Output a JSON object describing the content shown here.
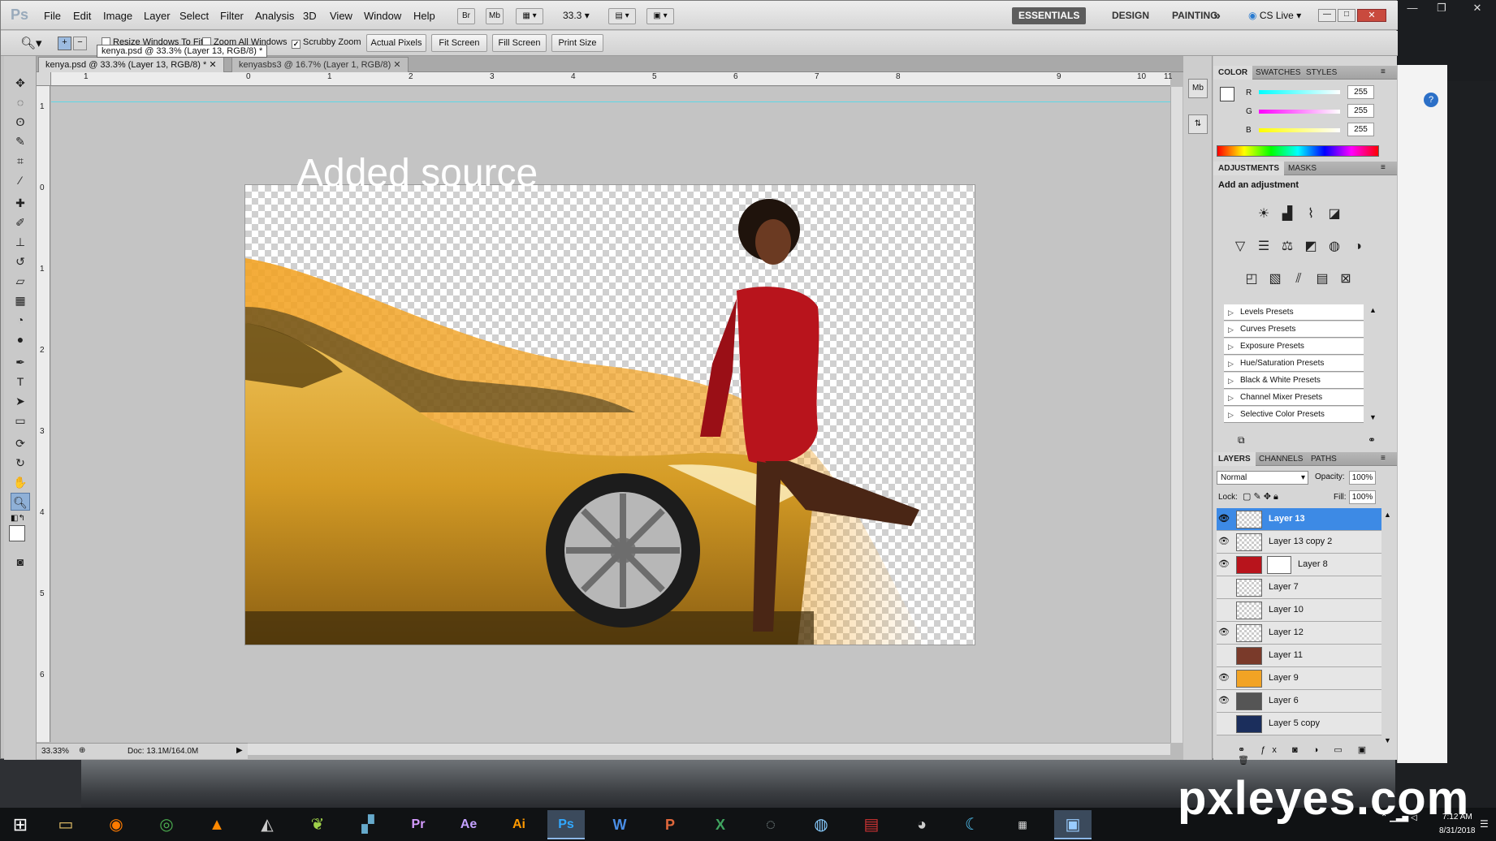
{
  "app": {
    "logo": "Ps",
    "menus": [
      "File",
      "Edit",
      "Image",
      "Layer",
      "Select",
      "Filter",
      "Analysis",
      "3D",
      "View",
      "Window",
      "Help"
    ],
    "bridge_labels": [
      "Br",
      "Mb"
    ],
    "zoom": "33.3",
    "workspaces": [
      "ESSENTIALS",
      "DESIGN",
      "PAINTING"
    ],
    "more": "»",
    "cslive": "CS Live"
  },
  "options": {
    "resize": "Resize Windows To Fit",
    "zoom_all": "Zoom All Windows",
    "scrubby": "Scrubby Zoom",
    "actual": "Actual Pixels",
    "fit": "Fit Screen",
    "fill": "Fill Screen",
    "print": "Print Size",
    "tooltip": "kenya.psd @ 33.3% (Layer 13, RGB/8) *"
  },
  "tabs": [
    {
      "label": "kenya.psd @ 33.3% (Layer 13, RGB/8) *"
    },
    {
      "label": "kenyasbs3 @ 16.7% (Layer 1, RGB/8)"
    }
  ],
  "ruler": {
    "h": [
      "1",
      "0",
      "1",
      "2",
      "3",
      "4",
      "5",
      "6",
      "7",
      "8",
      "9",
      "10",
      "11"
    ],
    "v": [
      "1",
      "0",
      "1",
      "2",
      "3",
      "4",
      "5",
      "6"
    ]
  },
  "canvas": {
    "overlay_text": "Added source"
  },
  "status": {
    "zoom": "33.33%",
    "doc": "Doc: 13.1M/164.0M"
  },
  "color_panel": {
    "tabs": [
      "COLOR",
      "SWATCHES",
      "STYLES"
    ],
    "channels": [
      {
        "name": "R",
        "value": "255"
      },
      {
        "name": "G",
        "value": "255"
      },
      {
        "name": "B",
        "value": "255"
      }
    ]
  },
  "adjustments": {
    "tabs": [
      "ADJUSTMENTS",
      "MASKS"
    ],
    "heading": "Add an adjustment",
    "presets": [
      "Levels Presets",
      "Curves Presets",
      "Exposure Presets",
      "Hue/Saturation Presets",
      "Black & White Presets",
      "Channel Mixer Presets",
      "Selective Color Presets"
    ]
  },
  "layers_panel": {
    "tabs": [
      "LAYERS",
      "CHANNELS",
      "PATHS"
    ],
    "blend": "Normal",
    "opacity_label": "Opacity:",
    "opacity": "100%",
    "lock_label": "Lock:",
    "fill_label": "Fill:",
    "fill": "100%",
    "layers": [
      {
        "name": "Layer 13",
        "visible": true,
        "selected": true
      },
      {
        "name": "Layer 13 copy 2",
        "visible": true
      },
      {
        "name": "Layer 8",
        "visible": true
      },
      {
        "name": "Layer 7",
        "visible": false
      },
      {
        "name": "Layer 10",
        "visible": false
      },
      {
        "name": "Layer 12",
        "visible": true
      },
      {
        "name": "Layer 11",
        "visible": false
      },
      {
        "name": "Layer 9",
        "visible": true
      },
      {
        "name": "Layer 6",
        "visible": true
      },
      {
        "name": "Layer 5 copy",
        "visible": false
      }
    ]
  },
  "taskbar": {
    "clock": "7:12 AM",
    "date": "8/31/2018",
    "app_labels": [
      "Pr",
      "Ae",
      "Ai",
      "Ps",
      "W",
      "P",
      "X"
    ]
  },
  "watermark": "pxleyes.com",
  "colors": {
    "selection": "#3d8ae5",
    "guide": "#5fd7e6",
    "car": "#d9a12a",
    "dress": "#b8141c"
  }
}
